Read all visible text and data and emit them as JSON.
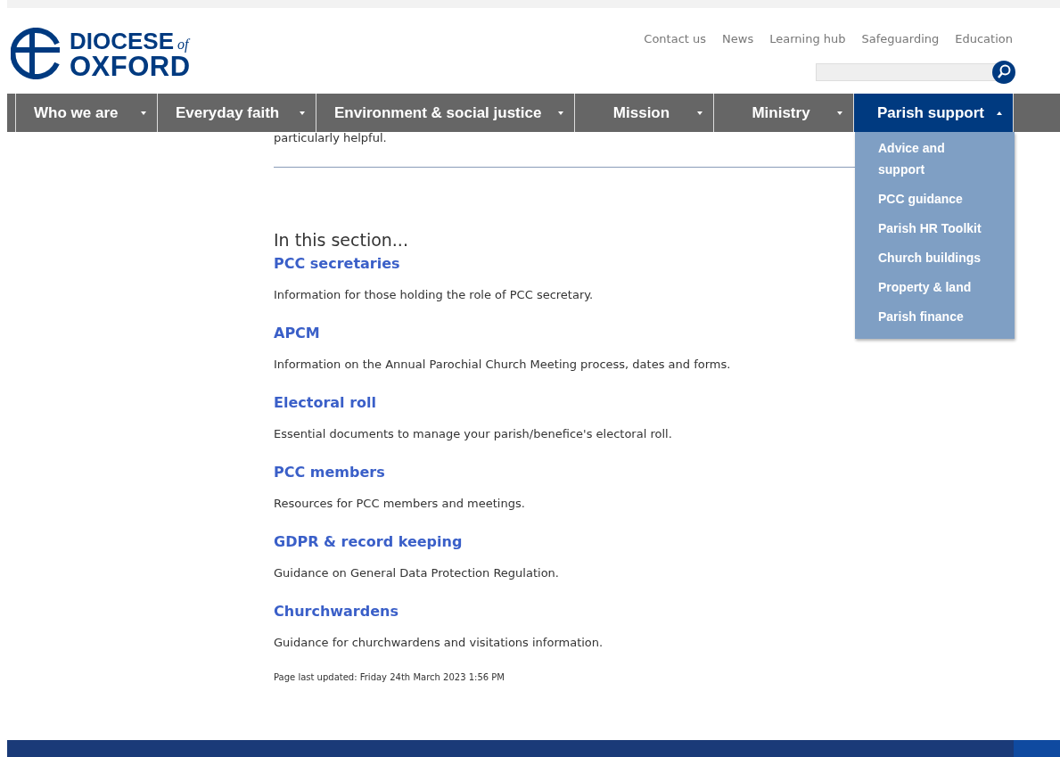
{
  "logo": {
    "line1": "DIOCESE",
    "of": "of",
    "line2": "OXFORD"
  },
  "top_links": [
    "Contact us",
    "News",
    "Learning hub",
    "Safeguarding",
    "Education"
  ],
  "nav": [
    {
      "label": "Who we are",
      "selected": false
    },
    {
      "label": "Everyday faith",
      "selected": false
    },
    {
      "label": "Environment & social justice",
      "selected": false
    },
    {
      "label": "Mission",
      "selected": false
    },
    {
      "label": "Ministry",
      "selected": false
    },
    {
      "label": "Parish support",
      "selected": true
    }
  ],
  "dropdown": [
    "Advice and support",
    "PCC guidance",
    "Parish HR Toolkit",
    "Church buildings",
    "Property & land",
    "Parish finance"
  ],
  "intro_tail": "particularly helpful.",
  "section_heading": "In this section...",
  "section_items": [
    {
      "title": "PCC secretaries",
      "description": "Information for those holding the role of PCC secretary."
    },
    {
      "title": "APCM",
      "description": "Information on the Annual Parochial Church Meeting process, dates and forms."
    },
    {
      "title": "Electoral roll",
      "description": "Essential documents to manage your parish/benefice's electoral roll."
    },
    {
      "title": "PCC members",
      "description": "Resources for PCC members and meetings."
    },
    {
      "title": "GDPR & record keeping",
      "description": "Guidance on General Data Protection Regulation."
    },
    {
      "title": "Churchwardens",
      "description": "Guidance for churchwardens and visitations information."
    }
  ],
  "last_updated": "Page last updated: Friday 24th March 2023 1:56 PM"
}
